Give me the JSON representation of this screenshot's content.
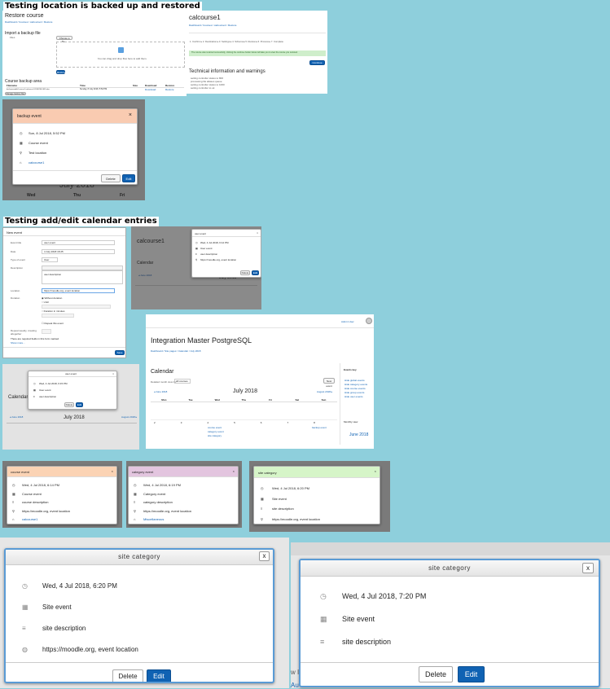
{
  "headings": {
    "restore": "Testing location is backed up and restored",
    "calendar": "Testing add/edit calendar entries"
  },
  "restore_shot": {
    "title": "Restore course",
    "breadcrumb": "Dashboard / Courses / calcourse1 / Restore",
    "import_title": "Import a backup file",
    "files_label": "Files",
    "choose_btn": "Choose a file...",
    "drop_text": "You can drag and drop files here to add them.",
    "restore_btn": "Restore",
    "course_backup_area": "Course backup area",
    "table_headers": [
      "Filename",
      "Time",
      "Size",
      "Download",
      "Restore"
    ],
    "table_row": [
      "backup-moodle2-course-5-calcourse1-20180708-1652.mbz",
      "Sunday, 8 July 2018, 5:52 PM",
      "",
      "Download",
      "Restore"
    ],
    "manage_btn": "Manage backup files"
  },
  "restore_done": {
    "course": "calcourse1",
    "breadcrumb": "Dashboard / Courses / calcourse1 / Restore",
    "steps": "1. Confirm ▸ 2. Destination ▸ 3. Settings ▸ 4. Schema ▸ 5. Review ▸ 6. Process ▸ 7. Complete",
    "success": "The course was restored successfully, clicking the continue button below will take you to view the course you restored.",
    "continue_btn": "Continue",
    "tech_title": "Technical information and warnings",
    "tech_lines": [
      "setting controller status to 800",
      "processing file aliases queue",
      "setting controller status to 1000",
      "setting controller to ok"
    ]
  },
  "backup_event": {
    "title": "backup event",
    "close": "×",
    "date": "Sun, 8 Jul 2018, 5:52 PM",
    "type": "Course event",
    "location": "Test location",
    "course": "calcourse1",
    "delete_btn": "Delete",
    "edit_btn": "Edit",
    "month": "July 2018",
    "days": [
      "Wed",
      "Thu",
      "Fri"
    ]
  },
  "new_event_form": {
    "title": "New event",
    "fields": [
      {
        "label": "Event title",
        "value": "user event"
      },
      {
        "label": "Date",
        "value": "4 July 2018 18 25"
      },
      {
        "label": "Type of event",
        "value": "User"
      },
      {
        "label": "Description",
        "value": "user description"
      },
      {
        "label": "Location",
        "value": "https://moodle.org, event location"
      },
      {
        "label": "Duration",
        "value": "Without duration"
      }
    ],
    "duration_opts": [
      "Until",
      "Duration in minutes"
    ],
    "repeat": "Repeat this event",
    "repeat_weekly": "Repeat weekly, creating altogether",
    "required_note": "There are required fields in this form marked",
    "show_more": "Show more...",
    "save_btn": "Save"
  },
  "user_event_small": {
    "course": "calcourse1",
    "calendar": "Calendar",
    "title": "user event",
    "date": "Wed, 4 Jul 2018, 6:12 PM",
    "type": "User event",
    "desc": "user description",
    "location": "https://moodle.org, event location",
    "delete_btn": "Delete",
    "edit_btn": "Edit",
    "month": "July 2018",
    "prev": "◂ June 2018"
  },
  "integration": {
    "site": "Integration Master PostgreSQL",
    "user": "Admin User",
    "breadcrumb": "Dashboard / Site pages / Calendar / July 2018",
    "calendar": "Calendar",
    "detailed_label": "Detailed month view for:",
    "select": "All courses",
    "new_event_btn": "New event",
    "prev": "◂ June 2018",
    "month": "July 2018",
    "next": "August 2018 ▸",
    "days": [
      "Mon",
      "Tue",
      "Wed",
      "Thu",
      "Fri",
      "Sat",
      "Sun"
    ],
    "week1": [
      "2",
      "3",
      "4",
      "5",
      "6",
      "7",
      "8"
    ],
    "events": [
      "course event",
      "category event",
      "site category"
    ],
    "backup": "backup event",
    "events_key": "Events key",
    "key_items": [
      "Hide global events",
      "Hide category events",
      "Hide course events",
      "Hide group events",
      "Hide user events"
    ],
    "monthly_view": "Monthly view",
    "mini_month": "June 2018"
  },
  "user_event_small2": {
    "calendar": "Calendar",
    "title": "user event",
    "date": "Wed, 4 Jul 2018, 6:15 PM",
    "type": "User event",
    "desc": "user description",
    "delete_btn": "Delete",
    "edit_btn": "Edit",
    "month": "July 2018",
    "prev": "◂ June 2018",
    "next": "August 2018 ▸"
  },
  "course_event": {
    "title": "course event",
    "date": "Wed, 4 Jul 2018, 6:14 PM",
    "type": "Course event",
    "desc": "course description",
    "location": "https://moodle.org, event location",
    "course": "calcourse1"
  },
  "category_event": {
    "title": "category event",
    "date": "Wed, 4 Jul 2018, 6:19 PM",
    "type": "Category event",
    "desc": "category description",
    "location": "https://moodle.org, event location",
    "category": "Miscellaneous"
  },
  "site_category_small": {
    "title": "site category",
    "date": "Wed, 4 Jul 2018, 6:20 PM",
    "type": "Site event",
    "desc": "site description",
    "location": "https://moodle.org, event location"
  },
  "site_category_left": {
    "title": "site category",
    "close": "x",
    "date": "Wed, 4 Jul 2018, 6:20 PM",
    "type": "Site event",
    "desc": "site description",
    "location": "https://moodle.org, event location",
    "delete_btn": "Delete",
    "edit_btn": "Edit"
  },
  "site_category_right": {
    "title": "site category",
    "close": "x",
    "date": "Wed, 4 Jul 2018, 7:20 PM",
    "type": "Site event",
    "desc": "site description",
    "delete_btn": "Delete",
    "edit_btn": "Edit",
    "behind_text": "w I",
    "behind_text2": "Au"
  },
  "colors": {
    "bg": "#8ecfdc",
    "primary": "#1062b3",
    "backup_header": "#f9cbb1",
    "course_header": "#fbd3b4",
    "category_header": "#e3c5df",
    "site_header": "#d6f5c8"
  }
}
